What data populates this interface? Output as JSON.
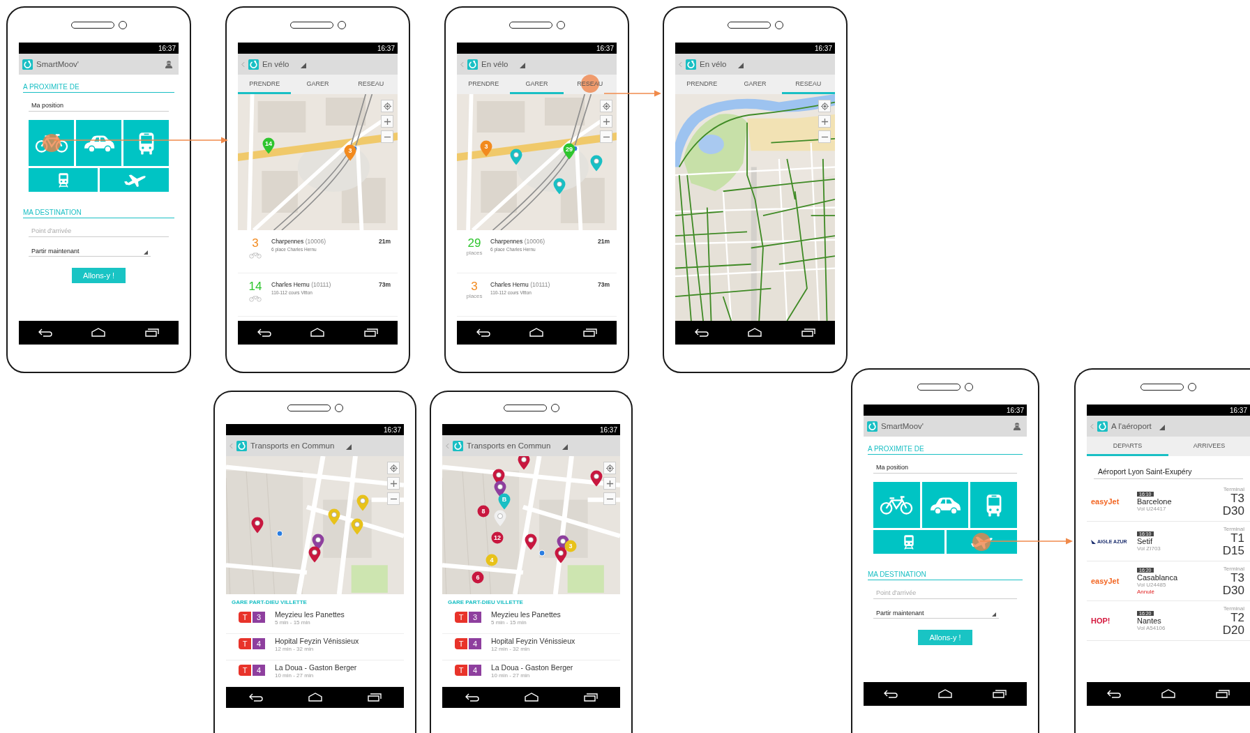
{
  "screens": [
    {
      "kind": "home",
      "time": "16:37",
      "title": "SmartMoov'",
      "near_heading": "A PROXIMITE DE",
      "position_field": {
        "value": "Ma position"
      },
      "tiles": [
        {
          "tapped": true
        },
        {
          "tapped": false
        },
        {
          "tapped": false
        },
        {
          "tapped": false
        },
        {
          "tapped": false
        }
      ],
      "destination_heading": "MA DESTINATION",
      "arrival_field": {
        "placeholder": "Point d'arrivée"
      },
      "departure_select": {
        "value": "Partir maintenant"
      },
      "go_button": "Allons-y !"
    },
    {
      "kind": "bike",
      "time": "16:37",
      "title": "En vélo",
      "tabs": [
        {
          "label": "PRENDRE",
          "selected": true,
          "tapped": false
        },
        {
          "label": "GARER",
          "selected": false,
          "tapped": false
        },
        {
          "label": "RESEAU",
          "selected": false,
          "tapped": false
        }
      ],
      "pins": [
        {
          "kind": "pin",
          "label": "14",
          "color": "#2ec52e"
        },
        {
          "kind": "pin",
          "label": "3",
          "color": "#f28a1e"
        }
      ],
      "stations": [
        {
          "count": "3",
          "color": "#f28a1e",
          "name": "**Charpennes** (10006)",
          "address": "6 place Charles Hernu",
          "distance": "21m"
        },
        {
          "count": "14",
          "color": "#2ec52e",
          "name": "**Charles Hernu** (10111)",
          "address": "110-112 cours Vitton",
          "distance": "73m"
        }
      ]
    },
    {
      "kind": "bike",
      "time": "16:37",
      "title": "En vélo",
      "tabs": [
        {
          "label": "PRENDRE",
          "selected": false,
          "tapped": false
        },
        {
          "label": "GARER",
          "selected": true,
          "tapped": false
        },
        {
          "label": "RESEAU",
          "selected": false,
          "tapped": true
        }
      ],
      "pins": [
        {
          "kind": "pin",
          "label": "3",
          "color": "#f28a1e"
        },
        {
          "kind": "pin",
          "color": "#19bfc4"
        },
        {
          "kind": "pin",
          "label": "29",
          "color": "#2ec52e"
        },
        {
          "kind": "pin",
          "color": "#19bfc4"
        },
        {
          "kind": "pin",
          "color": "#19bfc4"
        }
      ],
      "stations": [
        {
          "count": "29",
          "unit": "places",
          "color": "#2ec52e",
          "name": "**Charpennes** (10006)",
          "address": "6 place Charles Hernu",
          "distance": "21m"
        },
        {
          "count": "3",
          "unit": "places",
          "color": "#f28a1e",
          "name": "**Charles Hernu** (10111)",
          "address": "110-112 cours Vitton",
          "distance": "73m"
        }
      ]
    },
    {
      "kind": "bike",
      "time": "16:37",
      "title": "En vélo",
      "tabs": [
        {
          "label": "PRENDRE",
          "selected": false,
          "tapped": false
        },
        {
          "label": "GARER",
          "selected": false,
          "tapped": false
        },
        {
          "label": "RESEAU",
          "selected": true,
          "tapped": false
        }
      ]
    },
    {
      "kind": "transit",
      "time": "16:37",
      "title": "Transports en Commun",
      "pins": [
        {
          "kind": "pin",
          "color": "#c8173f"
        },
        {
          "kind": "pin",
          "color": "#e8c21a"
        },
        {
          "kind": "pin",
          "color": "#e8c21a"
        },
        {
          "kind": "pin",
          "color": "#e8c21a"
        },
        {
          "kind": "pin",
          "color": "#8e3f9e"
        },
        {
          "kind": "pin",
          "color": "#c8173f"
        }
      ],
      "stop_heading": "GARE PART-DIEU VILLETTE",
      "departures": [
        {
          "mode": "T",
          "line": "3",
          "destination": "Meyzieu les Panettes",
          "times": "5 min - 15 min"
        },
        {
          "mode": "T",
          "line": "4",
          "destination": "Hopital Feyzin Vénissieux",
          "times": "12 min - 32 min"
        },
        {
          "mode": "T",
          "line": "4",
          "destination": "La Doua - Gaston Berger",
          "times": "10 min - 27 min"
        }
      ]
    },
    {
      "kind": "transit",
      "time": "16:37",
      "title": "Transports en Commun",
      "pins": [
        {
          "kind": "pin",
          "color": "#c8173f"
        },
        {
          "kind": "pin",
          "color": "#c8173f"
        },
        {
          "kind": "pin",
          "color": "#8e3f9e"
        },
        {
          "kind": "pin",
          "label": "B",
          "color": "#19bfc4"
        },
        {
          "kind": "badge",
          "label": "8",
          "color": "#c8173f"
        },
        {
          "kind": "pin",
          "color": "#f0f0f0"
        },
        {
          "kind": "badge",
          "label": "12",
          "color": "#c8173f"
        },
        {
          "kind": "pin",
          "color": "#c8173f"
        },
        {
          "kind": "pin",
          "color": "#8e3f9e"
        },
        {
          "kind": "badge",
          "label": "3",
          "color": "#e8c21a"
        },
        {
          "kind": "pin",
          "color": "#c8173f"
        },
        {
          "kind": "badge",
          "label": "4",
          "color": "#e8c21a"
        },
        {
          "kind": "badge",
          "label": "6",
          "color": "#c8173f"
        },
        {
          "kind": "pin",
          "color": "#c8173f"
        }
      ],
      "stop_heading": "GARE PART-DIEU VILLETTE",
      "departures": [
        {
          "mode": "T",
          "line": "3",
          "destination": "Meyzieu les Panettes",
          "times": "5 min - 15 min"
        },
        {
          "mode": "T",
          "line": "4",
          "destination": "Hopital Feyzin Vénissieux",
          "times": "12 min - 32 min"
        },
        {
          "mode": "T",
          "line": "4",
          "destination": "La Doua - Gaston Berger",
          "times": "10 min - 27 min"
        }
      ]
    },
    {
      "kind": "home",
      "time": "16:37",
      "title": "SmartMoov'",
      "near_heading": "A PROXIMITE DE",
      "position_field": {
        "value": "Ma position"
      },
      "tiles": [
        {
          "tapped": false
        },
        {
          "tapped": false
        },
        {
          "tapped": false
        },
        {
          "tapped": false
        },
        {
          "tapped": true
        }
      ],
      "destination_heading": "MA DESTINATION",
      "arrival_field": {
        "placeholder": "Point d'arrivée"
      },
      "departure_select": {
        "value": "Partir maintenant"
      },
      "go_button": "Allons-y !"
    },
    {
      "kind": "airport",
      "time": "16:37",
      "title": "A l'aéroport",
      "tabs": [
        {
          "label": "DEPARTS",
          "selected": true,
          "tapped": false
        },
        {
          "label": "ARRIVEES",
          "selected": false,
          "tapped": false
        }
      ],
      "airport_field": {
        "value": "Aéroport Lyon Saint-Exupéry"
      },
      "flights": [
        {
          "airline": "easyJet",
          "color": "#f26522",
          "logo_mark": false,
          "time": "16:10",
          "city": "Barcelone",
          "flight": "Vol U24417",
          "terminal_label": "Terminal",
          "terminal": "T3",
          "gate": "D30"
        },
        {
          "airline": "AIGLE AZUR",
          "color": "#1d2f6f",
          "logo_mark": true,
          "time": "16:10",
          "city": "Setif",
          "flight": "Vol ZI703",
          "terminal_label": "Terminal",
          "terminal": "T1",
          "gate": "D15"
        },
        {
          "airline": "easyJet",
          "color": "#f26522",
          "logo_mark": false,
          "time": "16:20",
          "city": "Casablanca",
          "flight": "Vol U24485",
          "status": "Annulé",
          "terminal_label": "Terminal",
          "terminal": "T3",
          "gate": "D30"
        },
        {
          "airline": "HOP!",
          "color": "#d4163c",
          "logo_mark": false,
          "time": "16:20",
          "city": "Nantes",
          "flight": "Vol A54106",
          "terminal_label": "Terminal",
          "terminal": "T2",
          "gate": "D20"
        }
      ]
    }
  ]
}
